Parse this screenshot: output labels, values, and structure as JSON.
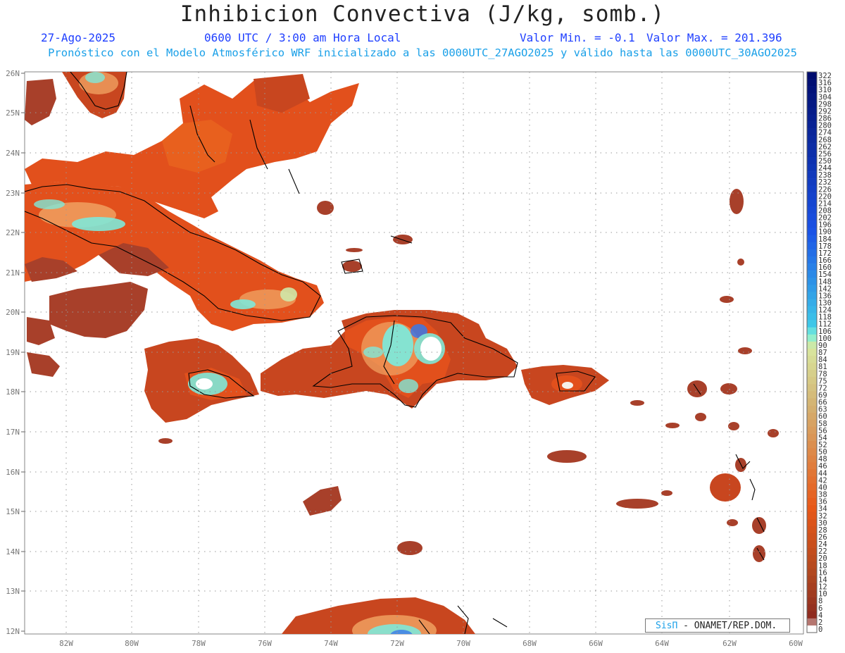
{
  "header": {
    "title": "Inhibicion Convectiva (J/kg, somb.)",
    "date": "27-Ago-2025",
    "time": "0600 UTC / 3:00 am Hora Local",
    "min_label": "Valor Min. = -0.1",
    "max_label": "Valor Max. = 201.396",
    "model_line": "Pronóstico con el Modelo Atmosférico WRF inicializado a las 0000UTC_27AGO2025 y válido hasta las  0000UTC_30AGO2025"
  },
  "axes": {
    "lat_labels": [
      "26N",
      "25N",
      "24N",
      "23N",
      "22N",
      "21N",
      "20N",
      "19N",
      "18N",
      "17N",
      "16N",
      "15N",
      "14N",
      "13N",
      "12N"
    ],
    "lon_labels": [
      "82W",
      "80W",
      "78W",
      "76W",
      "74W",
      "72W",
      "70W",
      "68W",
      "66W",
      "64W",
      "62W",
      "60W"
    ]
  },
  "colorbar": {
    "labels": [
      "322",
      "316",
      "310",
      "304",
      "298",
      "292",
      "286",
      "280",
      "274",
      "268",
      "262",
      "256",
      "250",
      "244",
      "238",
      "232",
      "226",
      "220",
      "214",
      "208",
      "202",
      "196",
      "190",
      "184",
      "178",
      "172",
      "166",
      "160",
      "154",
      "148",
      "142",
      "136",
      "130",
      "124",
      "118",
      "112",
      "106",
      "100",
      "90",
      "87",
      "84",
      "81",
      "78",
      "75",
      "72",
      "69",
      "66",
      "63",
      "60",
      "58",
      "56",
      "54",
      "52",
      "50",
      "48",
      "46",
      "44",
      "42",
      "40",
      "38",
      "36",
      "34",
      "32",
      "30",
      "28",
      "26",
      "24",
      "22",
      "20",
      "18",
      "16",
      "14",
      "12",
      "10",
      "8",
      "6",
      "4",
      "2",
      "0"
    ],
    "colors": {
      "high": "#000c6e",
      "upper": "#1a52e6",
      "mid": "#3ec8e8",
      "cyan": "#7ff0d8",
      "yellow_green": "#d8e8a0",
      "tan": "#d4b070",
      "orange": "#e85818",
      "brick": "#b04820",
      "low": "#8c2a20",
      "zero": "#ffffff"
    }
  },
  "field_colors": {
    "base": "#a8402a",
    "orange": "#e2501c",
    "light": "#f0a060",
    "cyan": "#7fe8d8",
    "blue": "#3a78e8",
    "white": "#ffffff"
  },
  "credit": {
    "brand": "SisΠ",
    "text": " - ONAMET/REP.DOM."
  }
}
